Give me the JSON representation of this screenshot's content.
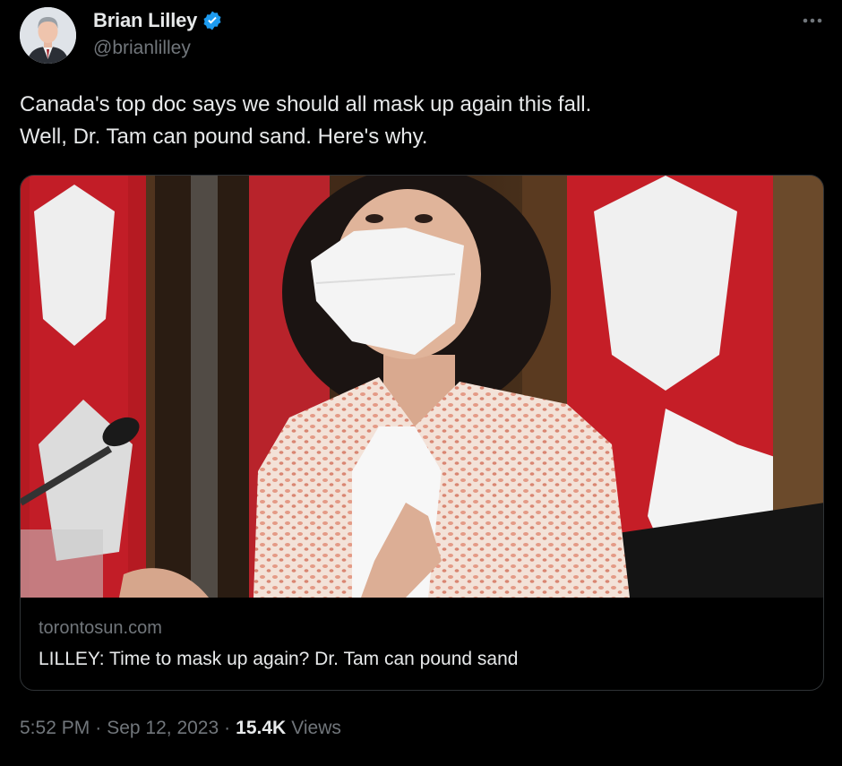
{
  "author": {
    "display_name": "Brian Lilley",
    "handle": "@brianlilley",
    "avatar_icon": "person-portrait-avatar",
    "verified_icon": "verified-badge-icon",
    "verified_color": "#1d9bf0"
  },
  "tweet": {
    "text_lines": [
      "Canada's top doc says we should all mask up again this fall.",
      "Well, Dr. Tam can pound sand. Here's why."
    ]
  },
  "card": {
    "image_icon": "woman-in-mask-photo",
    "domain": "torontosun.com",
    "title": "LILLEY: Time to mask up again? Dr. Tam can pound sand"
  },
  "meta": {
    "time": "5:52 PM",
    "date": "Sep 12, 2023",
    "separator": "·",
    "views_count": "15.4K",
    "views_label": "Views"
  },
  "more_icon": "more-horizontal-icon",
  "colors": {
    "background": "#000000",
    "text_primary": "#e7e9ea",
    "text_secondary": "#71767b",
    "border": "#2f3336",
    "accent": "#1d9bf0"
  }
}
